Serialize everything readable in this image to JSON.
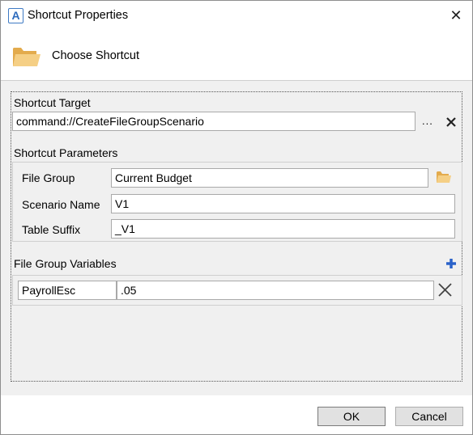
{
  "window": {
    "app_icon_letter": "A",
    "title": "Shortcut Properties",
    "close_glyph": "✕"
  },
  "header": {
    "icon": "folder-icon",
    "text": "Choose Shortcut"
  },
  "shortcut_target": {
    "label": "Shortcut Target",
    "value": "command://CreateFileGroupScenario",
    "browse_label": "...",
    "clear_icon": "close-icon"
  },
  "shortcut_parameters": {
    "label": "Shortcut Parameters",
    "file_group": {
      "label": "File Group",
      "value": "Current Budget",
      "icon": "folder-icon"
    },
    "scenario_name": {
      "label": "Scenario Name",
      "value": "V1"
    },
    "table_suffix": {
      "label": "Table Suffix",
      "value": "_V1"
    }
  },
  "file_group_variables": {
    "label": "File Group Variables",
    "add_icon": "plus-icon",
    "rows": [
      {
        "name": "PayrollEsc",
        "value": ".05",
        "remove_icon": "close-icon"
      }
    ]
  },
  "footer": {
    "ok_label": "OK",
    "cancel_label": "Cancel"
  },
  "colors": {
    "folder": "#f2c46f",
    "plus": "#2a62c9",
    "body_bg": "#f0f0f0",
    "app_icon": "#2d6bbd"
  }
}
